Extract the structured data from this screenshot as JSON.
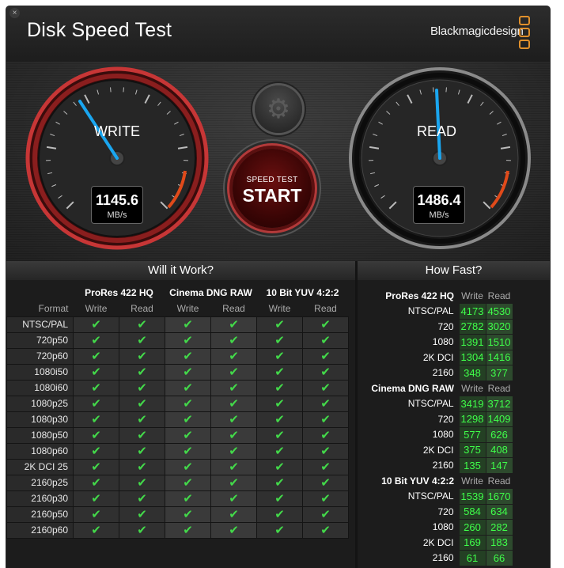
{
  "app": {
    "title": "Disk Speed Test",
    "brand": "Blackmagicdesign",
    "close_glyph": "×",
    "accent": "#e0902c"
  },
  "gauges": {
    "write": {
      "label": "WRITE",
      "value": "1145.6",
      "unit": "MB/s"
    },
    "read": {
      "label": "READ",
      "value": "1486.4",
      "unit": "MB/s"
    }
  },
  "start_button": {
    "line1": "SPEED TEST",
    "line2": "START"
  },
  "settings": {
    "icon": "gear-icon",
    "glyph": "⚙"
  },
  "will_it_work": {
    "heading": "Will it Work?",
    "format_label": "Format",
    "groups": [
      "ProRes 422 HQ",
      "Cinema DNG RAW",
      "10 Bit YUV 4:2:2"
    ],
    "sub": [
      "Write",
      "Read"
    ],
    "check": "✔",
    "rows": [
      "NTSC/PAL",
      "720p50",
      "720p60",
      "1080i50",
      "1080i60",
      "1080p25",
      "1080p30",
      "1080p50",
      "1080p60",
      "2K DCI 25",
      "2160p25",
      "2160p30",
      "2160p50",
      "2160p60"
    ]
  },
  "how_fast": {
    "heading": "How Fast?",
    "write_label": "Write",
    "read_label": "Read",
    "groups": [
      {
        "name": "ProRes 422 HQ",
        "rows": [
          {
            "label": "NTSC/PAL",
            "write": "4173",
            "read": "4530"
          },
          {
            "label": "720",
            "write": "2782",
            "read": "3020"
          },
          {
            "label": "1080",
            "write": "1391",
            "read": "1510"
          },
          {
            "label": "2K DCI",
            "write": "1304",
            "read": "1416"
          },
          {
            "label": "2160",
            "write": "348",
            "read": "377"
          }
        ]
      },
      {
        "name": "Cinema DNG RAW",
        "rows": [
          {
            "label": "NTSC/PAL",
            "write": "3419",
            "read": "3712"
          },
          {
            "label": "720",
            "write": "1298",
            "read": "1409"
          },
          {
            "label": "1080",
            "write": "577",
            "read": "626"
          },
          {
            "label": "2K DCI",
            "write": "375",
            "read": "408"
          },
          {
            "label": "2160",
            "write": "135",
            "read": "147"
          }
        ]
      },
      {
        "name": "10 Bit YUV 4:2:2",
        "rows": [
          {
            "label": "NTSC/PAL",
            "write": "1539",
            "read": "1670"
          },
          {
            "label": "720",
            "write": "584",
            "read": "634"
          },
          {
            "label": "1080",
            "write": "260",
            "read": "282"
          },
          {
            "label": "2K DCI",
            "write": "169",
            "read": "183"
          },
          {
            "label": "2160",
            "write": "61",
            "read": "66"
          }
        ]
      }
    ]
  }
}
